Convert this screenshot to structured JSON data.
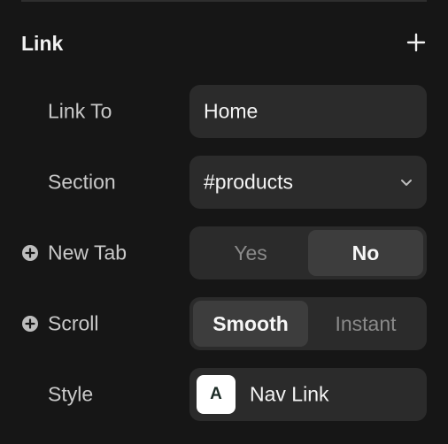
{
  "panel": {
    "section_title": "Link",
    "add_icon": "plus-icon"
  },
  "rows": {
    "link_to": {
      "label": "Link To",
      "value": "Home"
    },
    "section": {
      "label": "Section",
      "value": "#products",
      "icon": "chevron-down-icon"
    },
    "new_tab": {
      "label": "New Tab",
      "add_icon": "plus-circle-icon",
      "options": [
        "Yes",
        "No"
      ],
      "selected": "No"
    },
    "scroll": {
      "label": "Scroll",
      "add_icon": "plus-circle-icon",
      "options": [
        "Smooth",
        "Instant"
      ],
      "selected": "Smooth"
    },
    "style": {
      "label": "Style",
      "badge": "A",
      "value": "Nav Link"
    }
  },
  "colors": {
    "background": "#161616",
    "control": "#2b2b2b",
    "active_segment": "#3d3d3d",
    "label_text": "#c9c9c9",
    "muted_text": "#8a8a8a"
  }
}
